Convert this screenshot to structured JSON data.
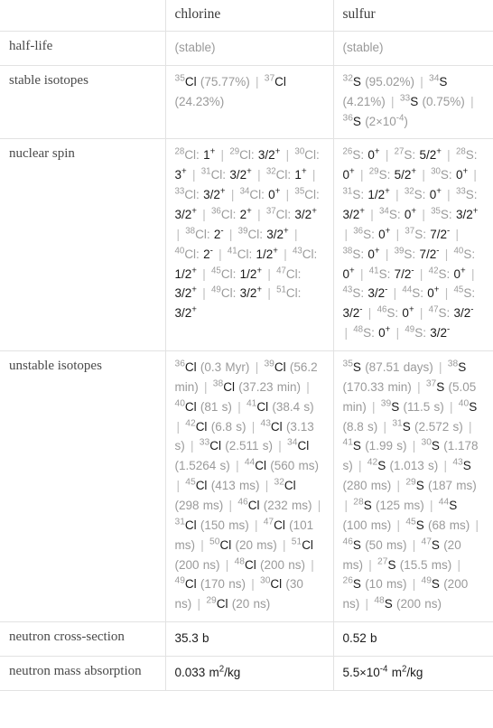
{
  "table": {
    "header": {
      "corner": "",
      "columns": [
        "chlorine",
        "sulfur"
      ]
    },
    "rows": [
      {
        "label": "half-life",
        "chlorine_html": "<span class=\"dim\">(stable)</span>",
        "sulfur_html": "<span class=\"dim\">(stable)</span>"
      },
      {
        "label": "stable isotopes",
        "chlorine_html": "<span class=\"iso\"><span class=\"mass\">35</span><span class=\"sym\">Cl</span></span> <span class=\"dim\">(75.77%)</span> <span class=\"sep\">|</span> <span class=\"iso\"><span class=\"mass\">37</span><span class=\"sym\">Cl</span></span> <span class=\"dim\">(24.23%)</span>",
        "sulfur_html": "<span class=\"iso\"><span class=\"mass\">32</span><span class=\"sym\">S</span></span> <span class=\"dim\">(95.02%)</span> <span class=\"sep\">|</span> <span class=\"iso\"><span class=\"mass\">34</span><span class=\"sym\">S</span></span> <span class=\"dim\">(4.21%)</span> <span class=\"sep\">|</span> <span class=\"iso\"><span class=\"mass\">33</span><span class=\"sym\">S</span></span> <span class=\"dim\">(0.75%)</span> <span class=\"sep\">|</span> <span class=\"iso\"><span class=\"mass\">36</span><span class=\"sym\">S</span></span> <span class=\"dim\">(2<span class=\"times\">&times;</span>10<sup>-4</sup>)</span>"
      },
      {
        "label": "nuclear spin",
        "chlorine_html": "<span class=\"spinlist\"><span class=\"elabel\"><sup>28</sup>Cl:</span> <span class=\"spin\">1<sup>+</sup></span> <span class=\"sep\">|</span> <span class=\"elabel\"><sup>29</sup>Cl:</span> <span class=\"spin\">3/2<sup>+</sup></span> <span class=\"sep\">|</span> <span class=\"elabel\"><sup>30</sup>Cl:</span> <span class=\"spin\">3<sup>+</sup></span> <span class=\"sep\">|</span> <span class=\"elabel\"><sup>31</sup>Cl:</span> <span class=\"spin\">3/2<sup>+</sup></span> <span class=\"sep\">|</span> <span class=\"elabel\"><sup>32</sup>Cl:</span> <span class=\"spin\">1<sup>+</sup></span> <span class=\"sep\">|</span> <span class=\"elabel\"><sup>33</sup>Cl:</span> <span class=\"spin\">3/2<sup>+</sup></span> <span class=\"sep\">|</span> <span class=\"elabel\"><sup>34</sup>Cl:</span> <span class=\"spin\">0<sup>+</sup></span> <span class=\"sep\">|</span> <span class=\"elabel\"><sup>35</sup>Cl:</span> <span class=\"spin\">3/2<sup>+</sup></span> <span class=\"sep\">|</span> <span class=\"elabel\"><sup>36</sup>Cl:</span> <span class=\"spin\">2<sup>+</sup></span> <span class=\"sep\">|</span> <span class=\"elabel\"><sup>37</sup>Cl:</span> <span class=\"spin\">3/2<sup>+</sup></span> <span class=\"sep\">|</span> <span class=\"elabel\"><sup>38</sup>Cl:</span> <span class=\"spin\">2<sup>-</sup></span> <span class=\"sep\">|</span> <span class=\"elabel\"><sup>39</sup>Cl:</span> <span class=\"spin\">3/2<sup>+</sup></span> <span class=\"sep\">|</span> <span class=\"elabel\"><sup>40</sup>Cl:</span> <span class=\"spin\">2<sup>-</sup></span> <span class=\"sep\">|</span> <span class=\"elabel\"><sup>41</sup>Cl:</span> <span class=\"spin\">1/2<sup>+</sup></span> <span class=\"sep\">|</span> <span class=\"elabel\"><sup>43</sup>Cl:</span> <span class=\"spin\">1/2<sup>+</sup></span> <span class=\"sep\">|</span> <span class=\"elabel\"><sup>45</sup>Cl:</span> <span class=\"spin\">1/2<sup>+</sup></span> <span class=\"sep\">|</span> <span class=\"elabel\"><sup>47</sup>Cl:</span> <span class=\"spin\">3/2<sup>+</sup></span> <span class=\"sep\">|</span> <span class=\"elabel\"><sup>49</sup>Cl:</span> <span class=\"spin\">3/2<sup>+</sup></span> <span class=\"sep\">|</span> <span class=\"elabel\"><sup>51</sup>Cl:</span> <span class=\"spin\">3/2<sup>+</sup></span></span>",
        "sulfur_html": "<span class=\"spinlist\"><span class=\"elabel\"><sup>26</sup>S:</span> <span class=\"spin\">0<sup>+</sup></span> <span class=\"sep\">|</span> <span class=\"elabel\"><sup>27</sup>S:</span> <span class=\"spin\">5/2<sup>+</sup></span> <span class=\"sep\">|</span> <span class=\"elabel\"><sup>28</sup>S:</span> <span class=\"spin\">0<sup>+</sup></span> <span class=\"sep\">|</span> <span class=\"elabel\"><sup>29</sup>S:</span> <span class=\"spin\">5/2<sup>+</sup></span> <span class=\"sep\">|</span> <span class=\"elabel\"><sup>30</sup>S:</span> <span class=\"spin\">0<sup>+</sup></span> <span class=\"sep\">|</span> <span class=\"elabel\"><sup>31</sup>S:</span> <span class=\"spin\">1/2<sup>+</sup></span> <span class=\"sep\">|</span> <span class=\"elabel\"><sup>32</sup>S:</span> <span class=\"spin\">0<sup>+</sup></span> <span class=\"sep\">|</span> <span class=\"elabel\"><sup>33</sup>S:</span> <span class=\"spin\">3/2<sup>+</sup></span> <span class=\"sep\">|</span> <span class=\"elabel\"><sup>34</sup>S:</span> <span class=\"spin\">0<sup>+</sup></span> <span class=\"sep\">|</span> <span class=\"elabel\"><sup>35</sup>S:</span> <span class=\"spin\">3/2<sup>+</sup></span> <span class=\"sep\">|</span> <span class=\"elabel\"><sup>36</sup>S:</span> <span class=\"spin\">0<sup>+</sup></span> <span class=\"sep\">|</span> <span class=\"elabel\"><sup>37</sup>S:</span> <span class=\"spin\">7/2<sup>-</sup></span> <span class=\"sep\">|</span> <span class=\"elabel\"><sup>38</sup>S:</span> <span class=\"spin\">0<sup>+</sup></span> <span class=\"sep\">|</span> <span class=\"elabel\"><sup>39</sup>S:</span> <span class=\"spin\">7/2<sup>-</sup></span> <span class=\"sep\">|</span> <span class=\"elabel\"><sup>40</sup>S:</span> <span class=\"spin\">0<sup>+</sup></span> <span class=\"sep\">|</span> <span class=\"elabel\"><sup>41</sup>S:</span> <span class=\"spin\">7/2<sup>-</sup></span> <span class=\"sep\">|</span> <span class=\"elabel\"><sup>42</sup>S:</span> <span class=\"spin\">0<sup>+</sup></span> <span class=\"sep\">|</span> <span class=\"elabel\"><sup>43</sup>S:</span> <span class=\"spin\">3/2<sup>-</sup></span> <span class=\"sep\">|</span> <span class=\"elabel\"><sup>44</sup>S:</span> <span class=\"spin\">0<sup>+</sup></span> <span class=\"sep\">|</span> <span class=\"elabel\"><sup>45</sup>S:</span> <span class=\"spin\">3/2<sup>-</sup></span> <span class=\"sep\">|</span> <span class=\"elabel\"><sup>46</sup>S:</span> <span class=\"spin\">0<sup>+</sup></span> <span class=\"sep\">|</span> <span class=\"elabel\"><sup>47</sup>S:</span> <span class=\"spin\">3/2<sup>-</sup></span> <span class=\"sep\">|</span> <span class=\"elabel\"><sup>48</sup>S:</span> <span class=\"spin\">0<sup>+</sup></span> <span class=\"sep\">|</span> <span class=\"elabel\"><sup>49</sup>S:</span> <span class=\"spin\">3/2<sup>-</sup></span></span>"
      },
      {
        "label": "unstable isotopes",
        "chlorine_html": "<span class=\"iso\"><span class=\"mass\">36</span><span class=\"sym\">Cl</span></span> <span class=\"dim\">(0.3 Myr)</span> <span class=\"sep\">|</span> <span class=\"iso\"><span class=\"mass\">39</span><span class=\"sym\">Cl</span></span> <span class=\"dim\">(56.2 min)</span> <span class=\"sep\">|</span> <span class=\"iso\"><span class=\"mass\">38</span><span class=\"sym\">Cl</span></span> <span class=\"dim\">(37.23 min)</span> <span class=\"sep\">|</span> <span class=\"iso\"><span class=\"mass\">40</span><span class=\"sym\">Cl</span></span> <span class=\"dim\">(81 s)</span> <span class=\"sep\">|</span> <span class=\"iso\"><span class=\"mass\">41</span><span class=\"sym\">Cl</span></span> <span class=\"dim\">(38.4 s)</span> <span class=\"sep\">|</span> <span class=\"iso\"><span class=\"mass\">42</span><span class=\"sym\">Cl</span></span> <span class=\"dim\">(6.8 s)</span> <span class=\"sep\">|</span> <span class=\"iso\"><span class=\"mass\">43</span><span class=\"sym\">Cl</span></span> <span class=\"dim\">(3.13 s)</span> <span class=\"sep\">|</span> <span class=\"iso\"><span class=\"mass\">33</span><span class=\"sym\">Cl</span></span> <span class=\"dim\">(2.511 s)</span> <span class=\"sep\">|</span> <span class=\"iso\"><span class=\"mass\">34</span><span class=\"sym\">Cl</span></span> <span class=\"dim\">(1.5264 s)</span> <span class=\"sep\">|</span> <span class=\"iso\"><span class=\"mass\">44</span><span class=\"sym\">Cl</span></span> <span class=\"dim\">(560 ms)</span> <span class=\"sep\">|</span> <span class=\"iso\"><span class=\"mass\">45</span><span class=\"sym\">Cl</span></span> <span class=\"dim\">(413 ms)</span> <span class=\"sep\">|</span> <span class=\"iso\"><span class=\"mass\">32</span><span class=\"sym\">Cl</span></span> <span class=\"dim\">(298 ms)</span> <span class=\"sep\">|</span> <span class=\"iso\"><span class=\"mass\">46</span><span class=\"sym\">Cl</span></span> <span class=\"dim\">(232 ms)</span> <span class=\"sep\">|</span> <span class=\"iso\"><span class=\"mass\">31</span><span class=\"sym\">Cl</span></span> <span class=\"dim\">(150 ms)</span> <span class=\"sep\">|</span> <span class=\"iso\"><span class=\"mass\">47</span><span class=\"sym\">Cl</span></span> <span class=\"dim\">(101 ms)</span> <span class=\"sep\">|</span> <span class=\"iso\"><span class=\"mass\">50</span><span class=\"sym\">Cl</span></span> <span class=\"dim\">(20 ms)</span> <span class=\"sep\">|</span> <span class=\"iso\"><span class=\"mass\">51</span><span class=\"sym\">Cl</span></span> <span class=\"dim\">(200 ns)</span> <span class=\"sep\">|</span> <span class=\"iso\"><span class=\"mass\">48</span><span class=\"sym\">Cl</span></span> <span class=\"dim\">(200 ns)</span> <span class=\"sep\">|</span> <span class=\"iso\"><span class=\"mass\">49</span><span class=\"sym\">Cl</span></span> <span class=\"dim\">(170 ns)</span> <span class=\"sep\">|</span> <span class=\"iso\"><span class=\"mass\">30</span><span class=\"sym\">Cl</span></span> <span class=\"dim\">(30 ns)</span> <span class=\"sep\">|</span> <span class=\"iso\"><span class=\"mass\">29</span><span class=\"sym\">Cl</span></span> <span class=\"dim\">(20 ns)</span>",
        "sulfur_html": "<span class=\"iso\"><span class=\"mass\">35</span><span class=\"sym\">S</span></span> <span class=\"dim\">(87.51 days)</span> <span class=\"sep\">|</span> <span class=\"iso\"><span class=\"mass\">38</span><span class=\"sym\">S</span></span> <span class=\"dim\">(170.33 min)</span> <span class=\"sep\">|</span> <span class=\"iso\"><span class=\"mass\">37</span><span class=\"sym\">S</span></span> <span class=\"dim\">(5.05 min)</span> <span class=\"sep\">|</span> <span class=\"iso\"><span class=\"mass\">39</span><span class=\"sym\">S</span></span> <span class=\"dim\">(11.5 s)</span> <span class=\"sep\">|</span> <span class=\"iso\"><span class=\"mass\">40</span><span class=\"sym\">S</span></span> <span class=\"dim\">(8.8 s)</span> <span class=\"sep\">|</span> <span class=\"iso\"><span class=\"mass\">31</span><span class=\"sym\">S</span></span> <span class=\"dim\">(2.572 s)</span> <span class=\"sep\">|</span> <span class=\"iso\"><span class=\"mass\">41</span><span class=\"sym\">S</span></span> <span class=\"dim\">(1.99 s)</span> <span class=\"sep\">|</span> <span class=\"iso\"><span class=\"mass\">30</span><span class=\"sym\">S</span></span> <span class=\"dim\">(1.178 s)</span> <span class=\"sep\">|</span> <span class=\"iso\"><span class=\"mass\">42</span><span class=\"sym\">S</span></span> <span class=\"dim\">(1.013 s)</span> <span class=\"sep\">|</span> <span class=\"iso\"><span class=\"mass\">43</span><span class=\"sym\">S</span></span> <span class=\"dim\">(280 ms)</span> <span class=\"sep\">|</span> <span class=\"iso\"><span class=\"mass\">29</span><span class=\"sym\">S</span></span> <span class=\"dim\">(187 ms)</span> <span class=\"sep\">|</span> <span class=\"iso\"><span class=\"mass\">28</span><span class=\"sym\">S</span></span> <span class=\"dim\">(125 ms)</span> <span class=\"sep\">|</span> <span class=\"iso\"><span class=\"mass\">44</span><span class=\"sym\">S</span></span> <span class=\"dim\">(100 ms)</span> <span class=\"sep\">|</span> <span class=\"iso\"><span class=\"mass\">45</span><span class=\"sym\">S</span></span> <span class=\"dim\">(68 ms)</span> <span class=\"sep\">|</span> <span class=\"iso\"><span class=\"mass\">46</span><span class=\"sym\">S</span></span> <span class=\"dim\">(50 ms)</span> <span class=\"sep\">|</span> <span class=\"iso\"><span class=\"mass\">47</span><span class=\"sym\">S</span></span> <span class=\"dim\">(20 ms)</span> <span class=\"sep\">|</span> <span class=\"iso\"><span class=\"mass\">27</span><span class=\"sym\">S</span></span> <span class=\"dim\">(15.5 ms)</span> <span class=\"sep\">|</span> <span class=\"iso\"><span class=\"mass\">26</span><span class=\"sym\">S</span></span> <span class=\"dim\">(10 ms)</span> <span class=\"sep\">|</span> <span class=\"iso\"><span class=\"mass\">49</span><span class=\"sym\">S</span></span> <span class=\"dim\">(200 ns)</span> <span class=\"sep\">|</span> <span class=\"iso\"><span class=\"mass\">48</span><span class=\"sym\">S</span></span> <span class=\"dim\">(200 ns)</span>"
      },
      {
        "label": "neutron cross-section",
        "chlorine_html": "35.3 b",
        "sulfur_html": "0.52 b"
      },
      {
        "label": "neutron mass absorption",
        "chlorine_html": "0.033 m<sup>2</sup>/kg",
        "sulfur_html": "5.5<span class=\"times\">&times;</span>10<sup>-4</sup> m<sup>2</sup>/kg"
      }
    ]
  },
  "colors": {
    "border": "#e2e2e2",
    "text": "#3b3b3b",
    "dim": "#9a9a9a",
    "value": "#1a1a1a"
  }
}
